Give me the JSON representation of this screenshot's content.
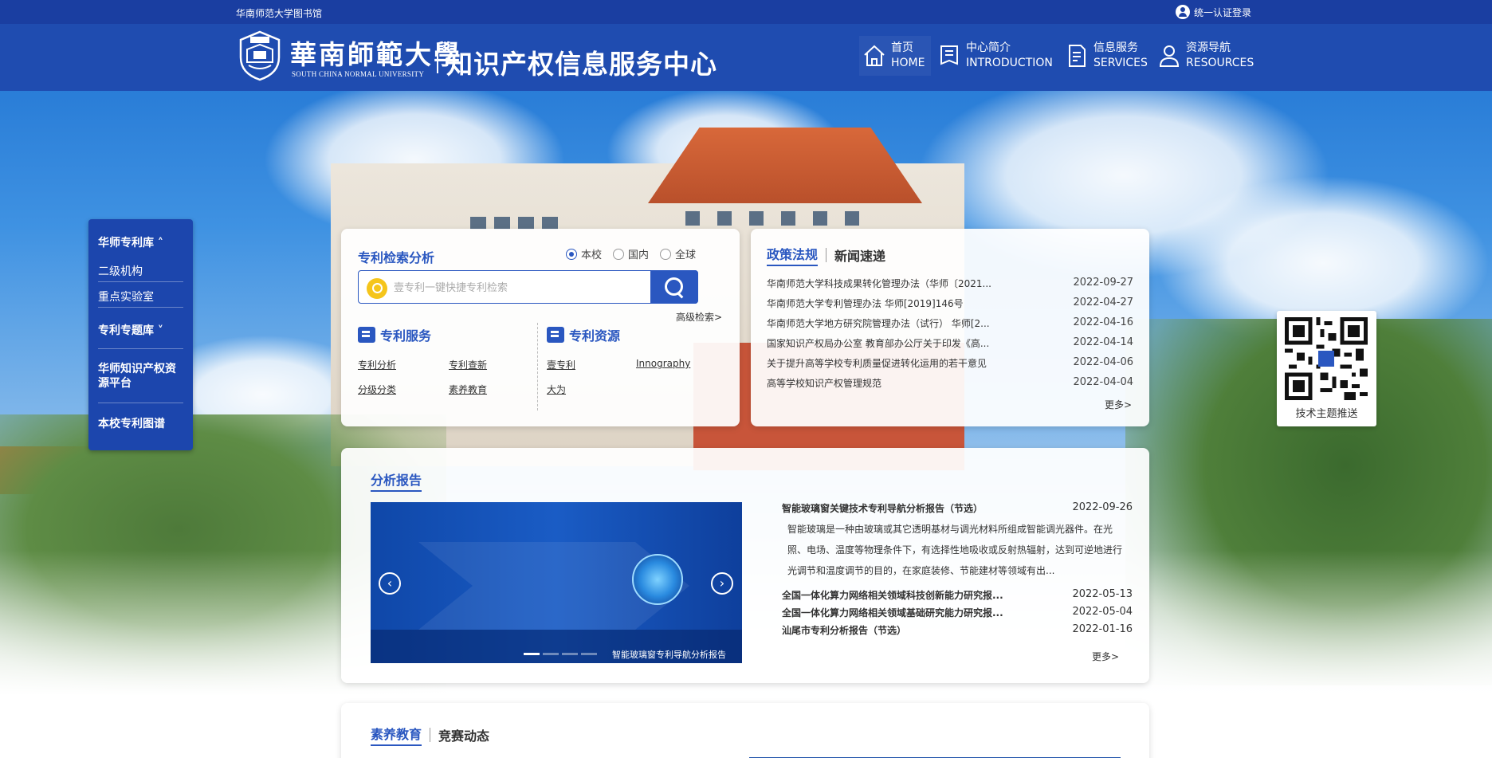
{
  "topbar": {
    "library": "华南师范大学图书馆",
    "login": "统一认证登录"
  },
  "header": {
    "logo_cn": "華南師範大學",
    "logo_en": "SOUTH CHINA NORMAL UNIVERSITY",
    "title": "知识产权信息服务中心",
    "nav": [
      {
        "cn": "首页",
        "en": "HOME",
        "icon": "home-icon"
      },
      {
        "cn": "中心简介",
        "en": "INTRODUCTION",
        "icon": "book-icon"
      },
      {
        "cn": "信息服务",
        "en": "SERVICES",
        "icon": "document-icon"
      },
      {
        "cn": "资源导航",
        "en": "RESOURCES",
        "icon": "person-icon"
      }
    ]
  },
  "sidebar": {
    "patent_db": "华师专利库 ˄",
    "sub1": "二级机构",
    "sub2": "重点实验室",
    "topic_db": "专利专题库 ˅",
    "ip_platform": "华师知识产权资源平台",
    "patent_map": "本校专利图谱"
  },
  "search": {
    "title": "专利检索分析",
    "radios": [
      "本校",
      "国内",
      "全球"
    ],
    "selected": "本校",
    "placeholder": "壹专利一键快捷专利检索",
    "advanced": "高级检索>",
    "services_title": "专利服务",
    "services": [
      "专利分析",
      "专利查新",
      "分级分类",
      "素养教育"
    ],
    "resources_title": "专利资源",
    "resources": [
      "壹专利",
      "Innography",
      "大为"
    ]
  },
  "policy": {
    "tab_active": "政策法规",
    "tab_other": "新闻速递",
    "items": [
      {
        "title": "华南师范大学科技成果转化管理办法（华师〔2021...",
        "date": "2022-09-27"
      },
      {
        "title": "华南师范大学专利管理办法 华师[2019]146号",
        "date": "2022-04-27"
      },
      {
        "title": "华南师范大学地方研究院管理办法（试行） 华师[2...",
        "date": "2022-04-16"
      },
      {
        "title": "国家知识产权局办公室 教育部办公厅关于印发《高...",
        "date": "2022-04-14"
      },
      {
        "title": "关于提升高等学校专利质量促进转化运用的若干意见",
        "date": "2022-04-06"
      },
      {
        "title": "高等学校知识产权管理规范",
        "date": "2022-04-04"
      }
    ],
    "more": "更多>"
  },
  "report": {
    "title": "分析报告",
    "banner_caption": "智能玻璃窗专利导航分析报告",
    "main_title": "智能玻璃窗关键技术专利导航分析报告（节选）",
    "main_date": "2022-09-26",
    "desc": "智能玻璃是一种由玻璃或其它透明基材与调光材料所组成智能调光器件。在光照、电场、温度等物理条件下，有选择性地吸收或反射热辐射，达到可逆地进行光调节和温度调节的目的，在家庭装修、节能建材等领域有出...",
    "items": [
      {
        "title": "全国一体化算力网络相关领域科技创新能力研究报...",
        "date": "2022-05-13"
      },
      {
        "title": "全国一体化算力网络相关领域基础研究能力研究报...",
        "date": "2022-05-04"
      },
      {
        "title": "汕尾市专利分析报告（节选）",
        "date": "2022-01-16"
      }
    ],
    "more": "更多>"
  },
  "edu": {
    "tab_active": "素养教育",
    "tab_other": "竞赛动态"
  },
  "qr": {
    "label": "技术主题推送"
  },
  "colors": {
    "brand_dark": "#1a3ea1",
    "brand": "#1f4cb0",
    "accent": "#2a57c0"
  }
}
